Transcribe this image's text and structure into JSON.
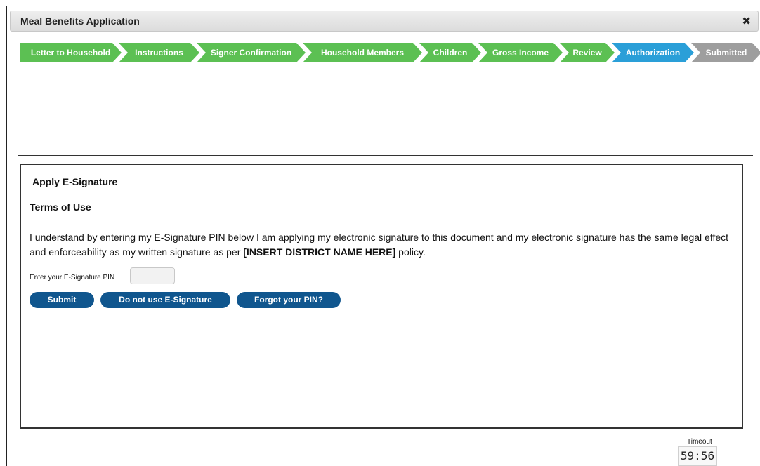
{
  "window": {
    "title": "Meal Benefits Application",
    "close_icon": "close-icon"
  },
  "steps": [
    {
      "label": "Letter to Household",
      "status": "complete"
    },
    {
      "label": "Instructions",
      "status": "complete"
    },
    {
      "label": "Signer Confirmation",
      "status": "complete"
    },
    {
      "label": "Household Members",
      "status": "complete"
    },
    {
      "label": "Children",
      "status": "complete"
    },
    {
      "label": "Gross Income",
      "status": "complete"
    },
    {
      "label": "Review",
      "status": "complete"
    },
    {
      "label": "Authorization",
      "status": "current"
    },
    {
      "label": "Submitted",
      "status": "pending"
    }
  ],
  "colors": {
    "complete": "#5cc053",
    "current": "#2a9fd8",
    "pending": "#9e9e9e",
    "button": "#10568e"
  },
  "panel": {
    "heading": "Apply E-Signature",
    "terms_title": "Terms of Use",
    "terms_text_before": "I understand by entering my E-Signature PIN below I am applying my electronic signature to this document and my electronic signature has the same legal effect and enforceability as my written signature as per ",
    "terms_text_bold": "[INSERT DISTRICT NAME HERE]",
    "terms_text_after": " policy.",
    "pin_label": "Enter your E-Signature PIN",
    "pin_value": "",
    "buttons": {
      "submit": "Submit",
      "no_esig": "Do not use E-Signature",
      "forgot": "Forgot your PIN?"
    }
  },
  "timeout": {
    "label": "Timeout",
    "value": "59:56"
  }
}
